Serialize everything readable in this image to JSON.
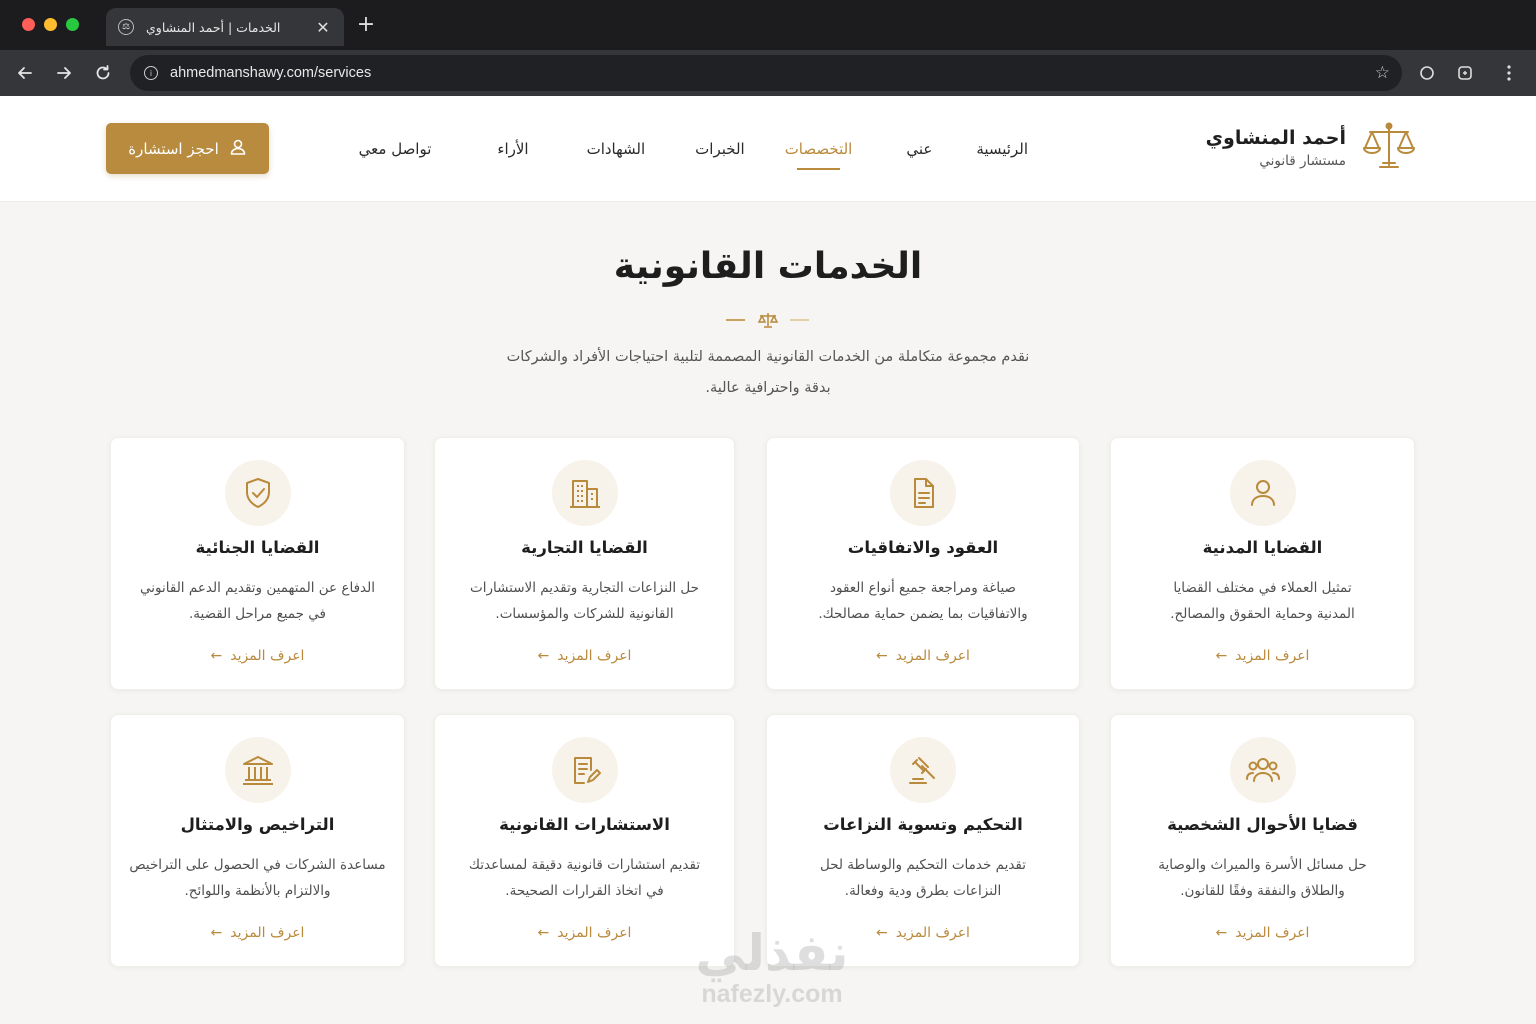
{
  "browser": {
    "tab_title": "الخدمات | أحمد المنشاوي",
    "url": "ahmedmanshawy.com/services",
    "colors": {
      "close": "#ff5f57",
      "minimize": "#febc2e",
      "zoom": "#28c840"
    }
  },
  "header": {
    "brand_name": "أحمد المنشاوي",
    "brand_subtitle": "مستشار قانوني",
    "nav": [
      {
        "label": "الرئيسية"
      },
      {
        "label": "عني"
      },
      {
        "label": "التخصصات",
        "active": true
      },
      {
        "label": "الخبرات"
      },
      {
        "label": "الشهادات"
      },
      {
        "label": "الأراء"
      },
      {
        "label": "تواصل معي"
      }
    ],
    "cta_label": "احجز استشارة",
    "accent_color": "#b88b3e"
  },
  "section": {
    "title": "الخدمات القانونية",
    "description_line1": "نقدم مجموعة متكاملة من الخدمات القانونية المصممة لتلبية احتياجات الأفراد والشركات",
    "description_line2": "بدقة واحترافية عالية."
  },
  "cards": [
    {
      "icon": "person-icon",
      "title": "القضايا المدنية",
      "desc1": "تمثيل العملاء في مختلف القضايا",
      "desc2": "المدنية وحماية الحقوق والمصالح.",
      "link": "اعرف المزيد"
    },
    {
      "icon": "document-icon",
      "title": "العقود والاتفاقيات",
      "desc1": "صياغة ومراجعة جميع أنواع العقود",
      "desc2": "والاتفاقيات بما يضمن حماية مصالحك.",
      "link": "اعرف المزيد"
    },
    {
      "icon": "building-icon",
      "title": "القضايا التجارية",
      "desc1": "حل النزاعات التجارية وتقديم الاستشارات",
      "desc2": "القانونية للشركات والمؤسسات.",
      "link": "اعرف المزيد"
    },
    {
      "icon": "shield-check-icon",
      "title": "القضايا الجنائية",
      "desc1": "الدفاع عن المتهمين وتقديم الدعم القانوني",
      "desc2": "في جميع مراحل القضية.",
      "link": "اعرف المزيد"
    },
    {
      "icon": "family-icon",
      "title": "قضايا الأحوال الشخصية",
      "desc1": "حل مسائل الأسرة والميراث والوصاية",
      "desc2": "والطلاق والنفقة وفقًا للقانون.",
      "link": "اعرف المزيد"
    },
    {
      "icon": "gavel-icon",
      "title": "التحكيم وتسوية النزاعات",
      "desc1": "تقديم خدمات التحكيم والوساطة لحل",
      "desc2": "النزاعات بطرق ودية وفعالة.",
      "link": "اعرف المزيد"
    },
    {
      "icon": "edit-document-icon",
      "title": "الاستشارات القانونية",
      "desc1": "تقديم استشارات قانونية دقيقة لمساعدتك",
      "desc2": "في اتخاذ القرارات الصحيحة.",
      "link": "اعرف المزيد"
    },
    {
      "icon": "institution-icon",
      "title": "التراخيص والامتثال",
      "desc1": "مساعدة الشركات في الحصول على التراخيص",
      "desc2": "والالتزام بالأنظمة واللوائح.",
      "link": "اعرف المزيد"
    }
  ],
  "watermark": {
    "arabic": "نفذلي",
    "latin": "nafezly.com"
  }
}
